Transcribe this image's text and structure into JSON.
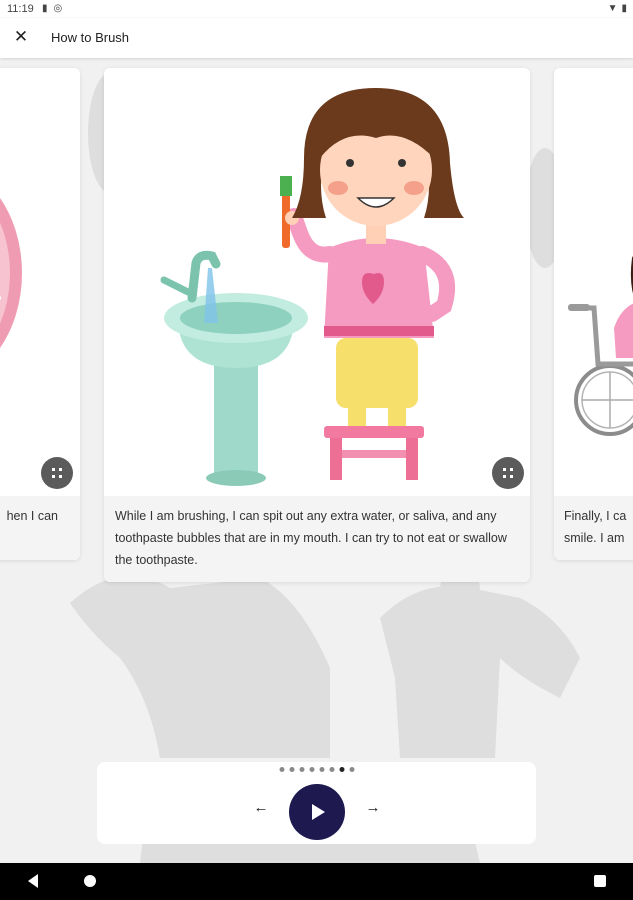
{
  "status_bar": {
    "time": "11:19",
    "icons": [
      "sim-card-icon",
      "settings-circle-icon"
    ],
    "right_icons": [
      "wifi-icon",
      "battery-icon"
    ]
  },
  "app_bar": {
    "title": "How to Brush",
    "close_icon": "close-icon"
  },
  "cards": {
    "left": {
      "text": "hen I can"
    },
    "center": {
      "text": "While I am brushing, I can spit out any extra water, or saliva, and any toothpaste bubbles that are in my mouth. I can try to not eat or swallow the toothpaste."
    },
    "right": {
      "text_line1": "Finally, I ca",
      "text_line2": "smile. I am"
    }
  },
  "pager": {
    "total_dots": 8,
    "active_dot": 7
  },
  "controls": {
    "prev_icon": "arrow-left-icon",
    "next_icon": "arrow-right-icon",
    "play_icon": "play-icon"
  },
  "colors": {
    "play_button": "#1e1a4f",
    "expand_button": "#5b5b5b",
    "background": "#f1f1f1"
  }
}
